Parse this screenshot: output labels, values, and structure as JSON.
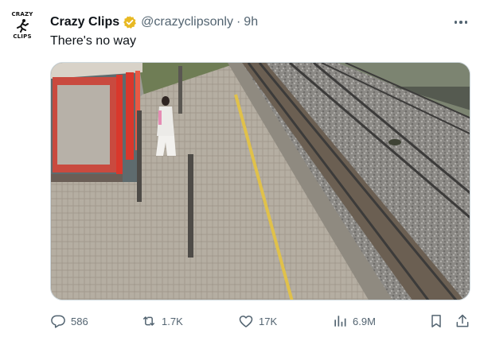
{
  "author": {
    "avatar_text_top": "CRAZY",
    "avatar_text_bottom": "CLIPS",
    "name": "Crazy Clips",
    "handle": "@crazyclipsonly",
    "separator": "·",
    "time": "9h",
    "verified_color": "#e8b923"
  },
  "tweet_text": "There's no way",
  "media": {
    "icon": "video-frame"
  },
  "actions": {
    "replies": "586",
    "reposts": "1.7K",
    "likes": "17K",
    "views": "6.9M"
  },
  "colors": {
    "text": "#0f1419",
    "secondary": "#536471",
    "border": "#cfd9de"
  }
}
